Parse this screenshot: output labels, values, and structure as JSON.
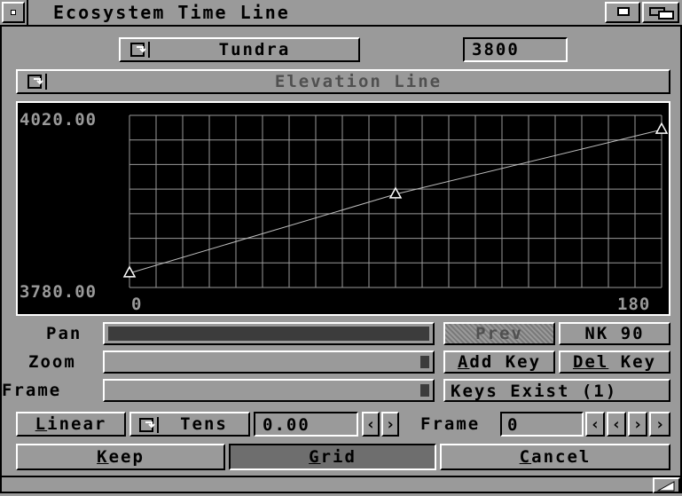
{
  "window": {
    "title": "Ecosystem Time Line"
  },
  "top": {
    "ecosystem": "Tundra",
    "value": "3800",
    "param": "Elevation Line"
  },
  "graph": {
    "y_max": "4020.00",
    "y_min": "3780.00",
    "x_min": "0",
    "x_max": "180"
  },
  "chart_data": {
    "type": "line",
    "x": [
      0,
      90,
      180
    ],
    "y": [
      3800,
      3910,
      4000
    ],
    "ylim": [
      3780,
      4020
    ],
    "xlim": [
      0,
      180
    ],
    "grid": true
  },
  "controls": {
    "pan_label": "Pan",
    "zoom_label": "Zoom",
    "frame_label": "Frame",
    "prev": "Prev",
    "nk": "NK 90",
    "add_key_u": "A",
    "add_key_rest": "dd Key",
    "del_key_u": "D",
    "del_key_mid": "el",
    "del_key_rest": " Key",
    "keys_exist": "Keys Exist (1)",
    "linear_u": "L",
    "linear_rest": "inear",
    "tens": "Tens",
    "tens_value": "0.00",
    "frame_label2": "Frame",
    "frame_value": "0"
  },
  "bottom": {
    "keep_u": "K",
    "keep_rest": "eep",
    "grid_u": "G",
    "grid_rest": "rid",
    "cancel_u": "C",
    "cancel_rest": "ancel"
  },
  "colors": {
    "bg": "#9a9a9a",
    "graph_bg": "#000000",
    "grid": "#9a9a9a",
    "dark": "#3c3c3c"
  }
}
